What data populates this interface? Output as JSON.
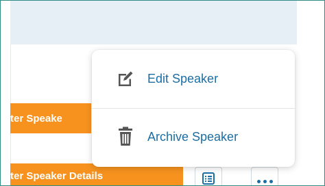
{
  "background_buttons": {
    "register_speaker_label": "ter Speake",
    "register_speaker_details_label": "ter Speaker Details"
  },
  "row_actions": {
    "list_icon": "list-icon",
    "more_icon": "more-icon"
  },
  "context_menu": {
    "items": [
      {
        "label": "Edit Speaker",
        "icon": "edit-icon"
      },
      {
        "label": "Archive Speaker",
        "icon": "trash-icon"
      }
    ]
  },
  "colors": {
    "accent_blue": "#1b6ea3",
    "orange": "#f7921e",
    "frame_teal": "#2e8b84",
    "header_band": "#e6eff6",
    "icon_gray": "#555555"
  }
}
